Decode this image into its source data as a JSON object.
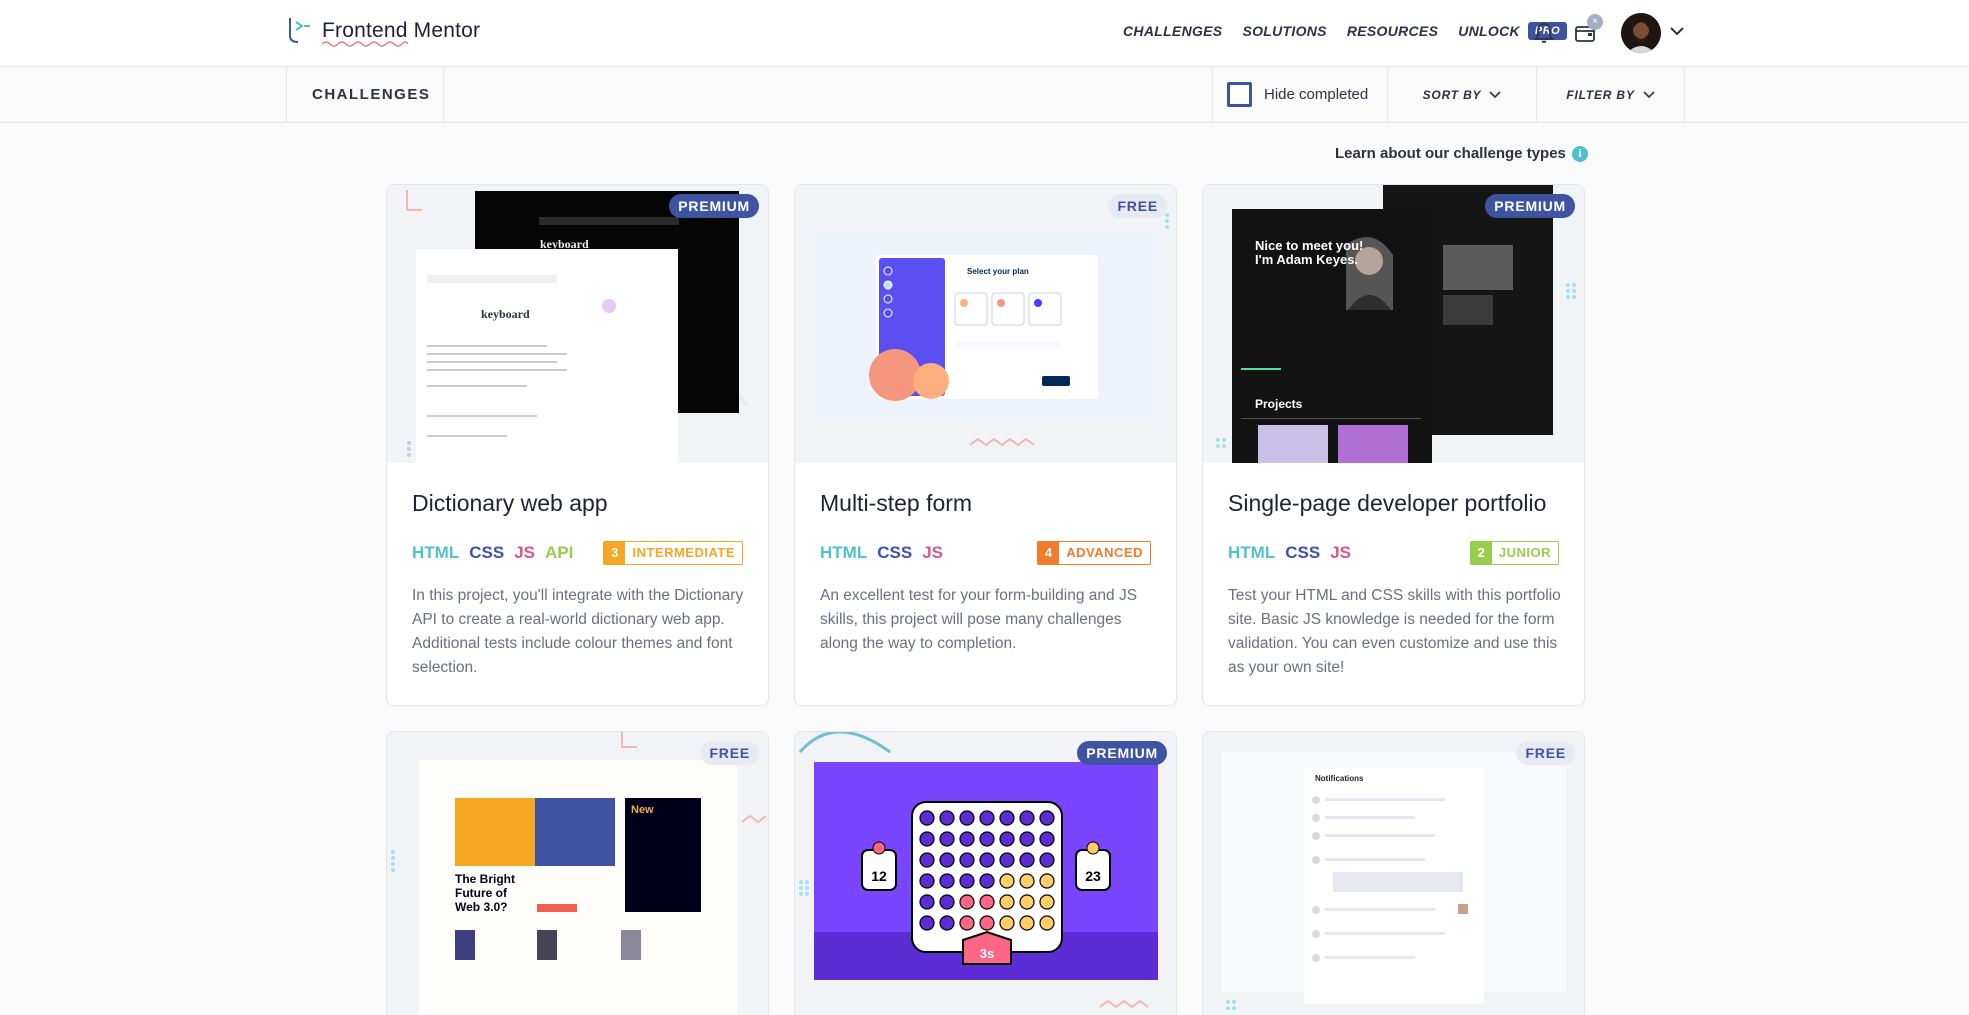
{
  "nav": {
    "logo_text": "Frontend Mentor",
    "links": [
      "CHALLENGES",
      "SOLUTIONS",
      "RESOURCES",
      "UNLOCK"
    ],
    "pro_badge": "PRO",
    "wallet_badge": "×"
  },
  "subbar": {
    "title": "CHALLENGES",
    "hide_completed": "Hide completed",
    "sort_by": "SORT BY",
    "filter_by": "FILTER BY"
  },
  "learn_link": "Learn about our challenge types",
  "info_icon": "i",
  "colors": {
    "brand_blue": "#3e54a3",
    "html": "#4ec0d0",
    "css": "#3e54a3",
    "js": "#d4578f",
    "api": "#98cf4a",
    "intermediate": "#f5a623",
    "advanced": "#f27b2c",
    "junior": "#98cf4a"
  },
  "cards": [
    {
      "badge": "PREMIUM",
      "title": "Dictionary web app",
      "tags": [
        "HTML",
        "CSS",
        "JS",
        "API"
      ],
      "level_num": "3",
      "level_name": "INTERMEDIATE",
      "description": "In this project, you'll integrate with the Dictionary API to create a real-world dictionary web app. Additional tests include colour themes and font selection.",
      "preview_word": "keyboard"
    },
    {
      "badge": "FREE",
      "title": "Multi-step form",
      "tags": [
        "HTML",
        "CSS",
        "JS"
      ],
      "level_num": "4",
      "level_name": "ADVANCED",
      "description": "An excellent test for your form-building and JS skills, this project will pose many challenges along the way to completion.",
      "preview_heading": "Select your plan"
    },
    {
      "badge": "PREMIUM",
      "title": "Single-page developer portfolio",
      "tags": [
        "HTML",
        "CSS",
        "JS"
      ],
      "level_num": "2",
      "level_name": "JUNIOR",
      "description": "Test your HTML and CSS skills with this portfolio site. Basic JS knowledge is needed for the form validation. You can even customize and use this as your own site!",
      "preview_heading": "Nice to meet you! I'm Adam Keyes.",
      "preview_section": "Projects"
    },
    {
      "badge": "FREE",
      "preview_heading": "The Bright Future of Web 3.0?",
      "preview_side": "New"
    },
    {
      "badge": "PREMIUM",
      "preview_p1": "12",
      "preview_p2": "23",
      "preview_timer": "3s"
    },
    {
      "badge": "FREE",
      "preview_heading": "Notifications"
    }
  ]
}
